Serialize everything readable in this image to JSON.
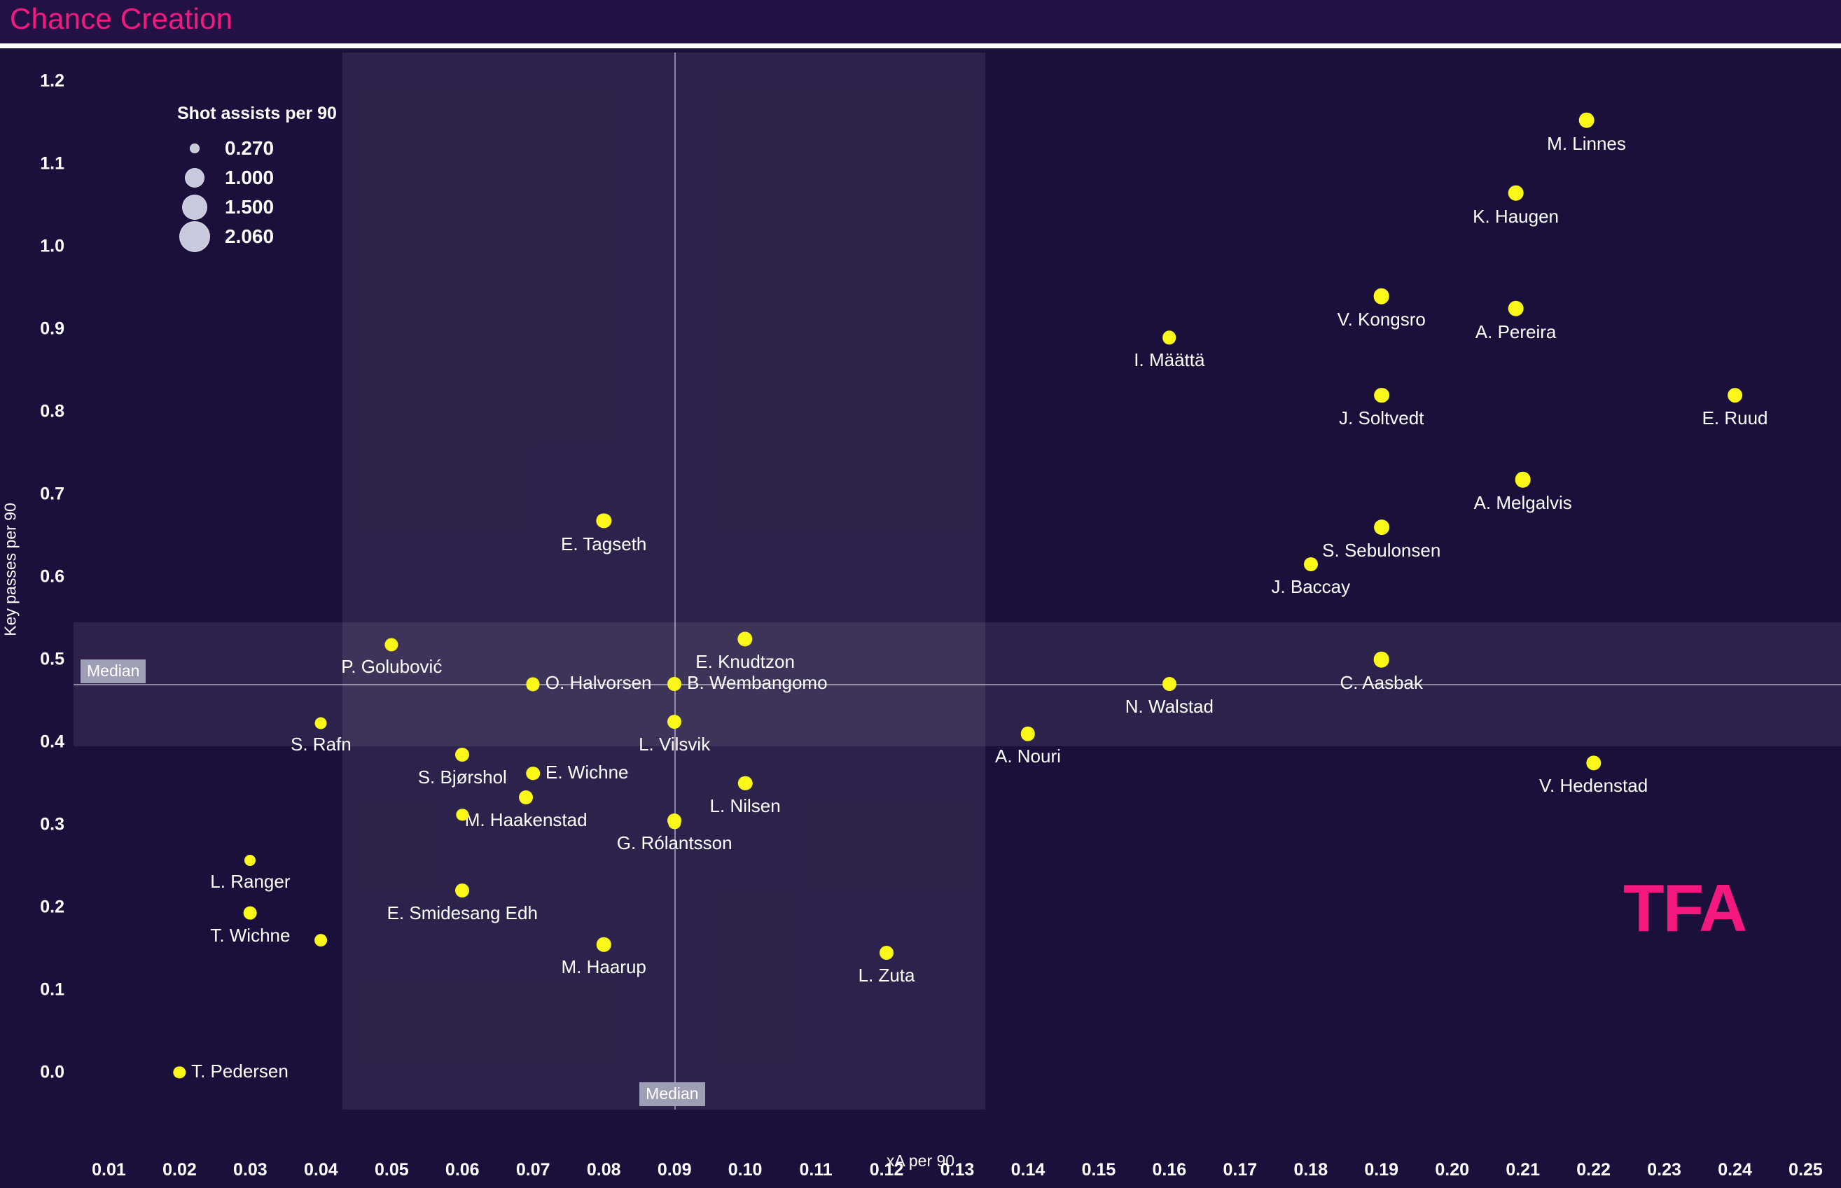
{
  "header": {
    "title": "Chance Creation",
    "accent_color": "#f5197f",
    "background_color": "#231145"
  },
  "watermark": {
    "text": "TFA",
    "color": "#f5197f"
  },
  "legend": {
    "title": "Shot assists per 90",
    "entries": [
      {
        "value": "0.270",
        "radius_px": 6
      },
      {
        "value": "1.000",
        "radius_px": 13
      },
      {
        "value": "1.500",
        "radius_px": 17
      },
      {
        "value": "2.060",
        "radius_px": 21
      }
    ]
  },
  "median_labels": {
    "y_label": "Median",
    "x_label": "Median"
  },
  "chart_data": {
    "type": "scatter",
    "title": "Chance Creation",
    "xlabel": "xA per 90",
    "ylabel": "Key passes per 90",
    "xlim": [
      0.005,
      0.255
    ],
    "ylim": [
      -0.045,
      1.235
    ],
    "xticks": [
      "0.01",
      "0.02",
      "0.03",
      "0.04",
      "0.05",
      "0.06",
      "0.07",
      "0.08",
      "0.09",
      "0.10",
      "0.11",
      "0.12",
      "0.13",
      "0.14",
      "0.15",
      "0.16",
      "0.17",
      "0.18",
      "0.19",
      "0.20",
      "0.21",
      "0.22",
      "0.23",
      "0.24",
      "0.25"
    ],
    "xtick_values": [
      0.01,
      0.02,
      0.03,
      0.04,
      0.05,
      0.06,
      0.07,
      0.08,
      0.09,
      0.1,
      0.11,
      0.12,
      0.13,
      0.14,
      0.15,
      0.16,
      0.17,
      0.18,
      0.19,
      0.2,
      0.21,
      0.22,
      0.23,
      0.24,
      0.25
    ],
    "yticks": [
      "0.0",
      "0.1",
      "0.2",
      "0.3",
      "0.4",
      "0.5",
      "0.6",
      "0.7",
      "0.8",
      "0.9",
      "1.0",
      "1.1",
      "1.2"
    ],
    "ytick_values": [
      0.0,
      0.1,
      0.2,
      0.3,
      0.4,
      0.5,
      0.6,
      0.7,
      0.8,
      0.9,
      1.0,
      1.1,
      1.2
    ],
    "grid": false,
    "legend_position": "top-left",
    "median_x": 0.09,
    "median_y": 0.47,
    "size_field": "Shot assists per 90",
    "point_color": "#fbf719",
    "background_color": "#1b0f3b",
    "quadrant_shade_color": "rgba(255,255,255,0.082)",
    "points": [
      {
        "name": "M. Linnes",
        "x": 0.219,
        "y": 1.153,
        "size": 1.55,
        "label_pos": "below"
      },
      {
        "name": "K. Haugen",
        "x": 0.209,
        "y": 1.065,
        "size": 1.55,
        "label_pos": "below"
      },
      {
        "name": "V. Kongsro",
        "x": 0.19,
        "y": 0.94,
        "size": 1.55,
        "label_pos": "below"
      },
      {
        "name": "A. Pereira",
        "x": 0.209,
        "y": 0.925,
        "size": 1.55,
        "label_pos": "below"
      },
      {
        "name": "I. Määttä",
        "x": 0.16,
        "y": 0.89,
        "size": 1.2,
        "label_pos": "below"
      },
      {
        "name": "J. Soltvedt",
        "x": 0.19,
        "y": 0.82,
        "size": 1.45,
        "label_pos": "below"
      },
      {
        "name": "E. Ruud",
        "x": 0.24,
        "y": 0.82,
        "size": 1.45,
        "label_pos": "below"
      },
      {
        "name": "A. Melgalvis",
        "x": 0.21,
        "y": 0.718,
        "size": 1.55,
        "label_pos": "below"
      },
      {
        "name": "S. Sebulonsen",
        "x": 0.19,
        "y": 0.66,
        "size": 1.45,
        "label_pos": "below"
      },
      {
        "name": "J. Baccay",
        "x": 0.18,
        "y": 0.615,
        "size": 1.25,
        "label_pos": "below"
      },
      {
        "name": "E. Tagseth",
        "x": 0.08,
        "y": 0.668,
        "size": 1.4,
        "label_pos": "below"
      },
      {
        "name": "E. Knudtzon",
        "x": 0.1,
        "y": 0.525,
        "size": 1.4,
        "label_pos": "below"
      },
      {
        "name": "P. Golubović",
        "x": 0.05,
        "y": 0.518,
        "size": 1.15,
        "label_pos": "below"
      },
      {
        "name": "O. Halvorsen",
        "x": 0.07,
        "y": 0.47,
        "size": 1.15,
        "label_pos": "right"
      },
      {
        "name": "C. Aasbak",
        "x": 0.19,
        "y": 0.5,
        "size": 1.55,
        "label_pos": "below"
      },
      {
        "name": "B. Wembangomo",
        "x": 0.09,
        "y": 0.47,
        "size": 1.25,
        "label_pos": "right"
      },
      {
        "name": "N. Walstad",
        "x": 0.16,
        "y": 0.47,
        "size": 1.25,
        "label_pos": "below"
      },
      {
        "name": "L. Vilsvik",
        "x": 0.09,
        "y": 0.425,
        "size": 1.25,
        "label_pos": "below"
      },
      {
        "name": "S. Rafn",
        "x": 0.04,
        "y": 0.423,
        "size": 0.9,
        "label_pos": "below"
      },
      {
        "name": "A. Nouri",
        "x": 0.14,
        "y": 0.41,
        "size": 1.3,
        "label_pos": "below"
      },
      {
        "name": "S. Bjørshol",
        "x": 0.06,
        "y": 0.385,
        "size": 1.25,
        "label_pos": "below"
      },
      {
        "name": "V. Hedenstad",
        "x": 0.22,
        "y": 0.375,
        "size": 1.4,
        "label_pos": "below"
      },
      {
        "name": "E. Wichne",
        "x": 0.07,
        "y": 0.362,
        "size": 1.2,
        "label_pos": "right"
      },
      {
        "name": "L. Nilsen",
        "x": 0.1,
        "y": 0.35,
        "size": 1.3,
        "label_pos": "below"
      },
      {
        "name": "M. Haakenstad",
        "x": 0.069,
        "y": 0.333,
        "size": 1.25,
        "label_pos": "below"
      },
      {
        "name": "G. Rólantsson",
        "x": 0.09,
        "y": 0.305,
        "size": 1.25,
        "label_pos": "below"
      },
      {
        "name": "L. Ranger",
        "x": 0.03,
        "y": 0.257,
        "size": 0.8,
        "label_pos": "below"
      },
      {
        "name": "E. Smidesang Edh",
        "x": 0.06,
        "y": 0.22,
        "size": 1.25,
        "label_pos": "below"
      },
      {
        "name": "T. Wichne",
        "x": 0.03,
        "y": 0.193,
        "size": 1.1,
        "label_pos": "below"
      },
      {
        "name": "M. Haarup",
        "x": 0.08,
        "y": 0.155,
        "size": 1.3,
        "label_pos": "below"
      },
      {
        "name": "L. Zuta",
        "x": 0.12,
        "y": 0.145,
        "size": 1.25,
        "label_pos": "below"
      },
      {
        "name": "T. Pedersen",
        "x": 0.02,
        "y": 0.0,
        "size": 0.95,
        "label_pos": "right"
      },
      {
        "name": "",
        "x": 0.04,
        "y": 0.16,
        "size": 1.0,
        "label_pos": "none"
      },
      {
        "name": "",
        "x": 0.09,
        "y": 0.302,
        "size": 0.95,
        "label_pos": "none"
      },
      {
        "name": "",
        "x": 0.06,
        "y": 0.312,
        "size": 0.95,
        "label_pos": "none"
      }
    ]
  }
}
